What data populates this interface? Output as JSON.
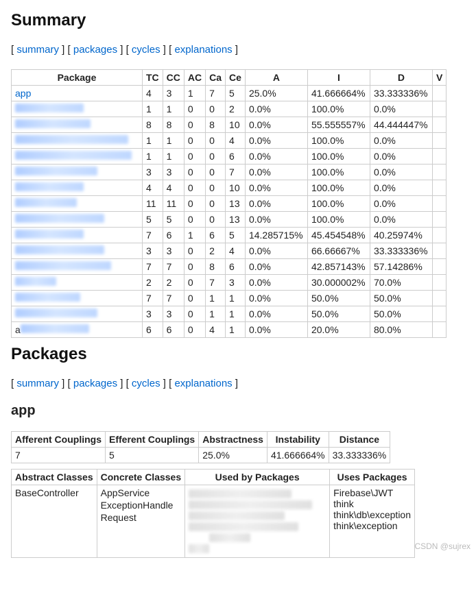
{
  "headings": {
    "summary": "Summary",
    "packages": "Packages",
    "app": "app"
  },
  "nav": {
    "summary": "summary",
    "packages": "packages",
    "cycles": "cycles",
    "explanations": "explanations"
  },
  "summary_table": {
    "headers": {
      "package": "Package",
      "tc": "TC",
      "cc": "CC",
      "ac": "AC",
      "ca": "Ca",
      "ce": "Ce",
      "a": "A",
      "i": "I",
      "d": "D",
      "v": "V"
    },
    "rows": [
      {
        "pkg_text": "app",
        "is_link": true,
        "blur_w": 0,
        "tc": "4",
        "cc": "3",
        "ac": "1",
        "ca": "7",
        "ce": "5",
        "a": "25.0%",
        "i": "41.666664%",
        "d": "33.333336%",
        "v": ""
      },
      {
        "pkg_text": "",
        "is_link": false,
        "blur_w": 100,
        "tc": "1",
        "cc": "1",
        "ac": "0",
        "ca": "0",
        "ce": "2",
        "a": "0.0%",
        "i": "100.0%",
        "d": "0.0%",
        "v": ""
      },
      {
        "pkg_text": "",
        "is_link": false,
        "blur_w": 110,
        "tc": "8",
        "cc": "8",
        "ac": "0",
        "ca": "8",
        "ce": "10",
        "a": "0.0%",
        "i": "55.555557%",
        "d": "44.444447%",
        "v": ""
      },
      {
        "pkg_text": "",
        "is_link": false,
        "blur_w": 165,
        "tc": "1",
        "cc": "1",
        "ac": "0",
        "ca": "0",
        "ce": "4",
        "a": "0.0%",
        "i": "100.0%",
        "d": "0.0%",
        "v": ""
      },
      {
        "pkg_text": "",
        "is_link": false,
        "blur_w": 170,
        "tc": "1",
        "cc": "1",
        "ac": "0",
        "ca": "0",
        "ce": "6",
        "a": "0.0%",
        "i": "100.0%",
        "d": "0.0%",
        "v": ""
      },
      {
        "pkg_text": "",
        "is_link": false,
        "blur_w": 120,
        "tc": "3",
        "cc": "3",
        "ac": "0",
        "ca": "0",
        "ce": "7",
        "a": "0.0%",
        "i": "100.0%",
        "d": "0.0%",
        "v": ""
      },
      {
        "pkg_text": "",
        "is_link": false,
        "blur_w": 100,
        "tc": "4",
        "cc": "4",
        "ac": "0",
        "ca": "0",
        "ce": "10",
        "a": "0.0%",
        "i": "100.0%",
        "d": "0.0%",
        "v": ""
      },
      {
        "pkg_text": "",
        "is_link": false,
        "blur_w": 90,
        "tc": "11",
        "cc": "11",
        "ac": "0",
        "ca": "0",
        "ce": "13",
        "a": "0.0%",
        "i": "100.0%",
        "d": "0.0%",
        "v": ""
      },
      {
        "pkg_text": "",
        "is_link": false,
        "blur_w": 130,
        "tc": "5",
        "cc": "5",
        "ac": "0",
        "ca": "0",
        "ce": "13",
        "a": "0.0%",
        "i": "100.0%",
        "d": "0.0%",
        "v": ""
      },
      {
        "pkg_text": "",
        "is_link": false,
        "blur_w": 100,
        "tc": "7",
        "cc": "6",
        "ac": "1",
        "ca": "6",
        "ce": "5",
        "a": "14.285715%",
        "i": "45.454548%",
        "d": "40.25974%",
        "v": ""
      },
      {
        "pkg_text": "",
        "is_link": false,
        "blur_w": 130,
        "tc": "3",
        "cc": "3",
        "ac": "0",
        "ca": "2",
        "ce": "4",
        "a": "0.0%",
        "i": "66.66667%",
        "d": "33.333336%",
        "v": ""
      },
      {
        "pkg_text": "",
        "is_link": false,
        "blur_w": 140,
        "tc": "7",
        "cc": "7",
        "ac": "0",
        "ca": "8",
        "ce": "6",
        "a": "0.0%",
        "i": "42.857143%",
        "d": "57.14286%",
        "v": ""
      },
      {
        "pkg_text": "",
        "is_link": false,
        "blur_w": 60,
        "tc": "2",
        "cc": "2",
        "ac": "0",
        "ca": "7",
        "ce": "3",
        "a": "0.0%",
        "i": "30.000002%",
        "d": "70.0%",
        "v": ""
      },
      {
        "pkg_text": "",
        "is_link": false,
        "blur_w": 95,
        "tc": "7",
        "cc": "7",
        "ac": "0",
        "ca": "1",
        "ce": "1",
        "a": "0.0%",
        "i": "50.0%",
        "d": "50.0%",
        "v": ""
      },
      {
        "pkg_text": "",
        "is_link": false,
        "blur_w": 120,
        "tc": "3",
        "cc": "3",
        "ac": "0",
        "ca": "1",
        "ce": "1",
        "a": "0.0%",
        "i": "50.0%",
        "d": "50.0%",
        "v": ""
      },
      {
        "pkg_text": "a",
        "is_link": false,
        "blur_w": 100,
        "tc": "6",
        "cc": "6",
        "ac": "0",
        "ca": "4",
        "ce": "1",
        "a": "0.0%",
        "i": "20.0%",
        "d": "80.0%",
        "v": ""
      }
    ]
  },
  "app_metrics": {
    "headers": {
      "afferent": "Afferent Couplings",
      "efferent": "Efferent Couplings",
      "abstractness": "Abstractness",
      "instability": "Instability",
      "distance": "Distance"
    },
    "values": {
      "afferent": "7",
      "efferent": "5",
      "abstractness": "25.0%",
      "instability": "41.666664%",
      "distance": "33.333336%"
    }
  },
  "app_classes": {
    "headers": {
      "abstract": "Abstract Classes",
      "concrete": "Concrete Classes",
      "used_by": "Used by Packages",
      "uses": "Uses Packages"
    },
    "abstract": [
      "BaseController"
    ],
    "concrete": [
      "AppService",
      "ExceptionHandle",
      "Request"
    ],
    "uses": [
      "Firebase\\JWT",
      "think",
      "think\\db\\exception",
      "think\\exception"
    ]
  },
  "watermark": "CSDN @sujrex"
}
